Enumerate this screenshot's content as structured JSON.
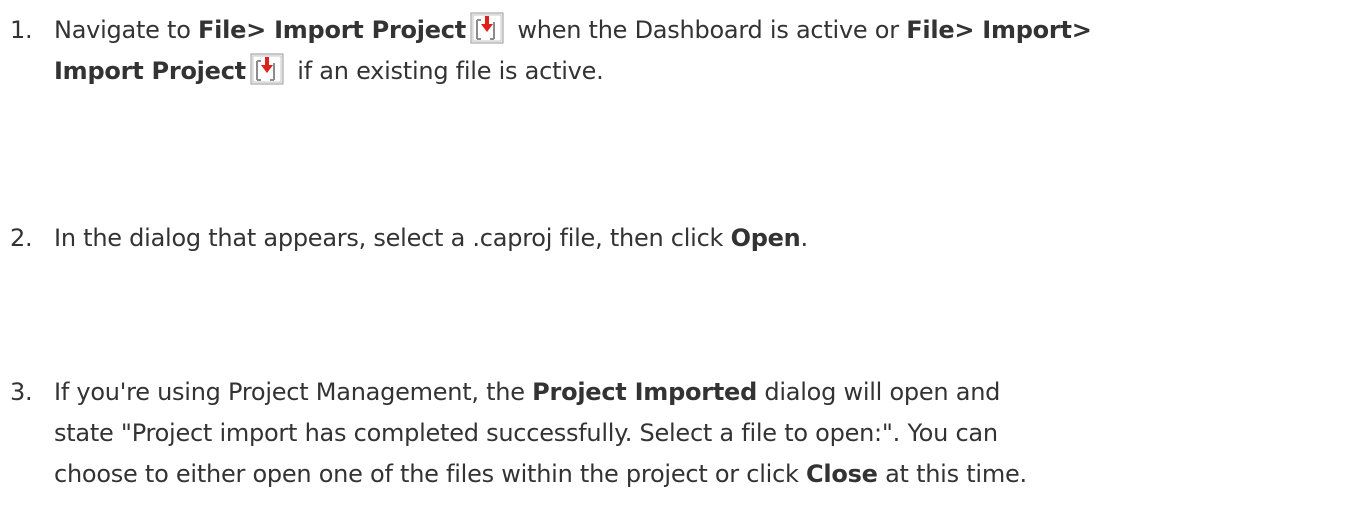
{
  "steps": [
    {
      "number": "1.",
      "parts": {
        "t1": "Navigate to ",
        "b1": "File> Import Project",
        "t2": " when the Dashboard is active or ",
        "b2": "File> Import>",
        "b3": "Import Project",
        "t3": " if an existing file is active."
      }
    },
    {
      "number": "2.",
      "parts": {
        "t1": "In the dialog that appears, select a .caproj file, then click ",
        "b1": "Open",
        "t2": "."
      }
    },
    {
      "number": "3.",
      "parts": {
        "t1": "If you're using Project Management, the ",
        "b1": "Project Imported",
        "t2": " dialog will open and",
        "t3": "state \"Project import has completed successfully. Select a file to open:\". You can",
        "t4": "choose to either open one of the files within the project or click ",
        "b2": "Close",
        "t5": " at this time."
      }
    }
  ],
  "icons": {
    "import_project": "import-project-icon"
  },
  "colors": {
    "text": "#333333",
    "icon_arrow": "#e0201b",
    "icon_frame": "#9a9a9a"
  }
}
